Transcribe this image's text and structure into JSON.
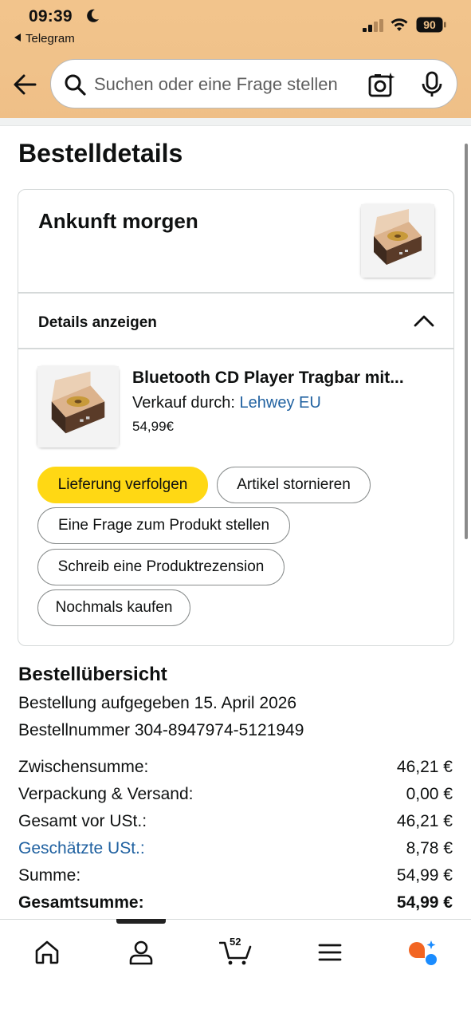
{
  "status": {
    "time": "09:39",
    "back_app": "Telegram",
    "battery": "90"
  },
  "search": {
    "placeholder": "Suchen oder eine Frage stellen"
  },
  "page": {
    "title": "Bestelldetails"
  },
  "shipment": {
    "arrival": "Ankunft morgen",
    "details_toggle": "Details anzeigen"
  },
  "product": {
    "title": "Bluetooth CD Player Tragbar mit...",
    "seller_prefix": "Verkauf durch: ",
    "seller_name": "Lehwey EU",
    "price": "54,99€"
  },
  "actions": {
    "track": "Lieferung verfolgen",
    "cancel": "Artikel stornieren",
    "ask": "Eine Frage zum Produkt stellen",
    "review": "Schreib eine Produktrezension",
    "buy_again": "Nochmals kaufen"
  },
  "summary": {
    "title": "Bestellübersicht",
    "placed": "Bestellung aufgegeben 15. April 2026",
    "order_number": "Bestellnummer 304-8947974-5121949",
    "rows": [
      {
        "label": "Zwischensumme:",
        "value": "46,21 €"
      },
      {
        "label": "Verpackung & Versand:",
        "value": "0,00 €"
      },
      {
        "label": "Gesamt vor USt.:",
        "value": "46,21 €"
      },
      {
        "label": "Geschätzte USt.:",
        "value": "8,78 €"
      },
      {
        "label": "Summe:",
        "value": "54,99 €"
      },
      {
        "label": "Gesamtsumme:",
        "value": "54,99 €"
      }
    ]
  },
  "nav": {
    "cart_count": "52",
    "items": [
      "home-icon",
      "account-icon",
      "cart-icon",
      "menu-icon",
      "rufus-ai-icon"
    ]
  },
  "colors": {
    "header": "#f0c28a",
    "primary_button": "#ffd814",
    "link": "#2162a1",
    "ai_orange": "#f26522",
    "ai_blue": "#1a8cff"
  }
}
